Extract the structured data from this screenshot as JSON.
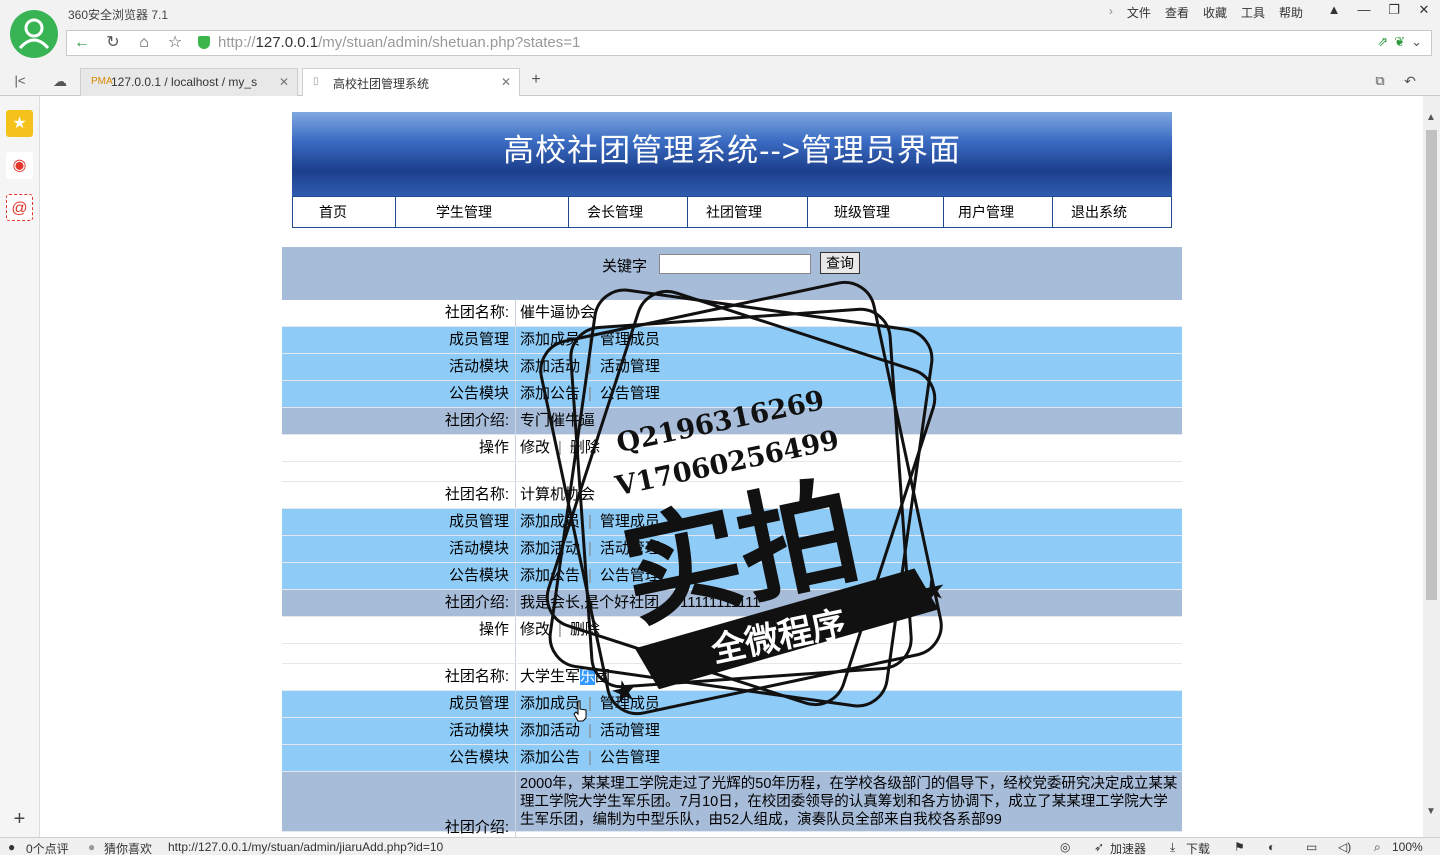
{
  "browser": {
    "app_title": "360安全浏览器 7.1",
    "menu": [
      "文件",
      "查看",
      "收藏",
      "工具",
      "帮助"
    ],
    "url_prefix": "http://",
    "url_host": "127.0.0.1",
    "url_path": "/my/stuan/admin/shetuan.php?states=1",
    "tabs": [
      {
        "label": "127.0.0.1 / localhost / my_s",
        "icon_text": "PMA"
      },
      {
        "label": "高校社团管理系统"
      }
    ],
    "accent_color": "#38b455"
  },
  "page": {
    "banner_title": "高校社团管理系统-->管理员界面",
    "nav": [
      "首页",
      "学生管理",
      "会长管理",
      "社团管理",
      "班级管理",
      "用户管理",
      "退出系统"
    ],
    "search": {
      "label": "关键字",
      "value": "",
      "button": "查询"
    },
    "clubs": [
      {
        "name_label": "社团名称:",
        "name": "催牛逼协会",
        "member_label": "成员管理",
        "member_add": "添加成员",
        "member_manage": "管理成员",
        "activity_label": "活动模块",
        "activity_add": "添加活动",
        "activity_manage": "活动管理",
        "notice_label": "公告模块",
        "notice_add": "添加公告",
        "notice_manage": "公告管理",
        "intro_label": "社团介绍:",
        "intro": "专门催牛逼",
        "op_label": "操作",
        "edit": "修改",
        "delete": "删除"
      },
      {
        "name_label": "社团名称:",
        "name": "计算机协会",
        "member_label": "成员管理",
        "member_add": "添加成员",
        "member_manage": "管理成员",
        "activity_label": "活动模块",
        "activity_add": "添加活动",
        "activity_manage": "活动管理",
        "notice_label": "公告模块",
        "notice_add": "添加公告",
        "notice_manage": "公告管理",
        "intro_label": "社团介绍:",
        "intro": "我是会长,是个好社团,....11111111111",
        "op_label": "操作",
        "edit": "修改",
        "delete": "删除"
      },
      {
        "name_label": "社团名称:",
        "name_a": "大学生军",
        "name_sel": "乐",
        "name_b": "团",
        "member_label": "成员管理",
        "member_add": "添加成员",
        "member_manage": "管理成员",
        "activity_label": "活动模块",
        "activity_add": "添加活动",
        "activity_manage": "活动管理",
        "notice_label": "公告模块",
        "notice_add": "添加公告",
        "notice_manage": "公告管理",
        "intro_label": "社团介绍:",
        "intro": "2000年，某某理工学院走过了光辉的50年历程，在学校各级部门的倡导下，经校党委研究决定成立某某理工学院大学生军乐团。7月10日，在校团委领导的认真筹划和各方协调下，成立了某某理工学院大学生军乐团，编制为中型乐队，由52人组成，演奏队员全部来自我校各系部99"
      }
    ]
  },
  "watermark": {
    "line1": "Q2196316269",
    "line2": "V17060256499",
    "big": "实拍",
    "ribbon": "全微程序"
  },
  "statusbar": {
    "comments": "0个点评",
    "guess": "猜你喜欢",
    "link": "http://127.0.0.1/my/stuan/admin/jiaruAdd.php?id=10",
    "accelerator": "加速器",
    "download": "下载",
    "zoom": "100%"
  }
}
